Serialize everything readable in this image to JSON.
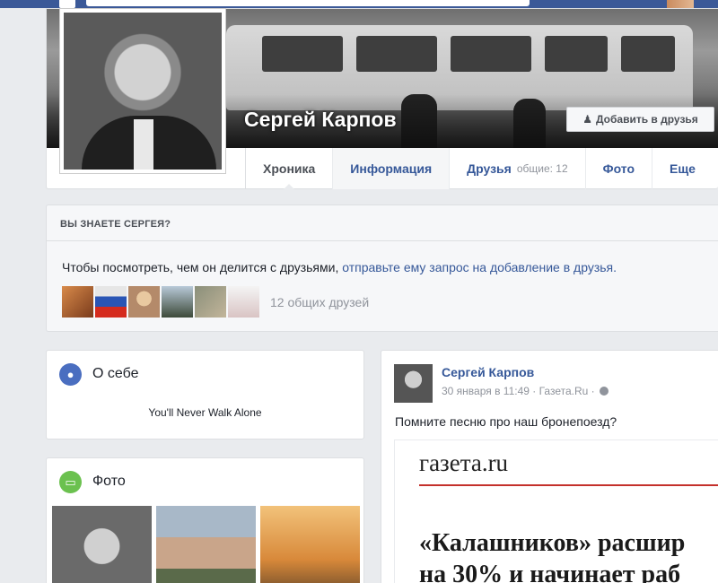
{
  "profile": {
    "name": "Сергей Карпов",
    "add_friend_label": "Добавить в друзья"
  },
  "tabs": [
    {
      "label": "Хроника"
    },
    {
      "label": "Информация"
    },
    {
      "label": "Друзья",
      "sub": "общие: 12"
    },
    {
      "label": "Фото"
    },
    {
      "label": "Еще"
    }
  ],
  "know": {
    "title": "ВЫ ЗНАЕТЕ СЕРГЕЯ?",
    "text": "Чтобы посмотреть, чем он делится с друзьями, ",
    "link": "отправьте ему запрос на добавление в друзья.",
    "mutual_count": "12 общих друзей"
  },
  "about": {
    "title": "О себе",
    "text": "You'll Never Walk Alone"
  },
  "photos": {
    "title": "Фото"
  },
  "post": {
    "author": "Сергей Карпов",
    "meta": "30 января в 11:49 · Газета.Ru ·",
    "text": "Помните песню про наш бронепоезд?",
    "media": {
      "logo": "газета.ru",
      "headline_line1": "«Калашников» расшир",
      "headline_line2": "на 30% и начинает раб"
    }
  },
  "colors": {
    "brand_blue": "#3b5998",
    "link_blue": "#365899",
    "accent_red": "#c4302b"
  },
  "icons": {
    "about": "globe-icon",
    "photos": "photo-icon",
    "add_friend": "add-person-icon"
  }
}
